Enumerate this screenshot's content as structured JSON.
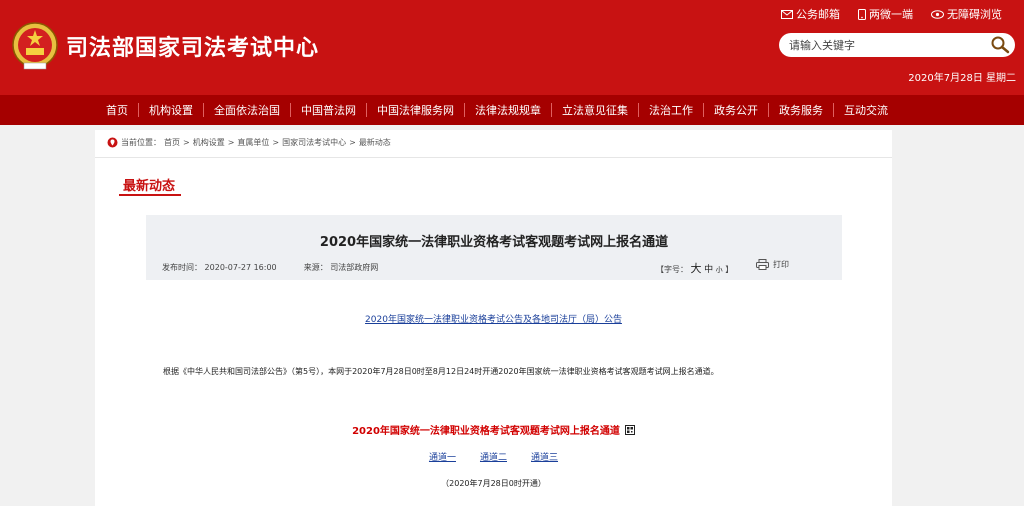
{
  "header": {
    "site_title": "司法部国家司法考试中心",
    "top_links": [
      {
        "label": "公务邮箱",
        "icon": "mail-icon"
      },
      {
        "label": "两微一端",
        "icon": "phone-icon"
      },
      {
        "label": "无障碍浏览",
        "icon": "eye-icon"
      }
    ],
    "search_placeholder": "请输入关键字",
    "date": "2020年7月28日 星期二"
  },
  "nav": {
    "items": [
      "首页",
      "机构设置",
      "全面依法治国",
      "中国普法网",
      "中国法律服务网",
      "法律法规规章",
      "立法意见征集",
      "法治工作",
      "政务公开",
      "政务服务",
      "互动交流"
    ]
  },
  "breadcrumb": {
    "label": "当前位置：",
    "items": [
      "首页",
      "机构设置",
      "直属单位",
      "国家司法考试中心",
      "最新动态"
    ],
    "separator": ">"
  },
  "section": {
    "title": "最新动态"
  },
  "article": {
    "title": "2020年国家统一法律职业资格考试客观题考试网上报名通道",
    "publish_label": "发布时间：",
    "publish_time": "2020-07-27 16:00",
    "source_label": "来源：",
    "source": "司法部政府网",
    "font_label": "【字号：",
    "font_big": "大",
    "font_mid": "中",
    "font_small": "小",
    "font_close": "】",
    "print_label": "打印",
    "notice_link": "2020年国家统一法律职业资格考试公告及各地司法厅（局）公告",
    "body": "根据《中华人民共和国司法部公告》（第5号），本网于2020年7月28日0时至8月12日24时开通2020年国家统一法律职业资格考试客观题考试网上报名通道。",
    "channel_title": "2020年国家统一法律职业资格考试客观题考试网上报名通道",
    "channels": [
      "通道一",
      "通道二",
      "通道三"
    ],
    "open_note": "（2020年7月28日0时开通）"
  },
  "colors": {
    "header_red": "#c81212",
    "nav_red": "#a50000",
    "link_blue": "#1a3f9a",
    "highlight_red": "#d10000"
  }
}
